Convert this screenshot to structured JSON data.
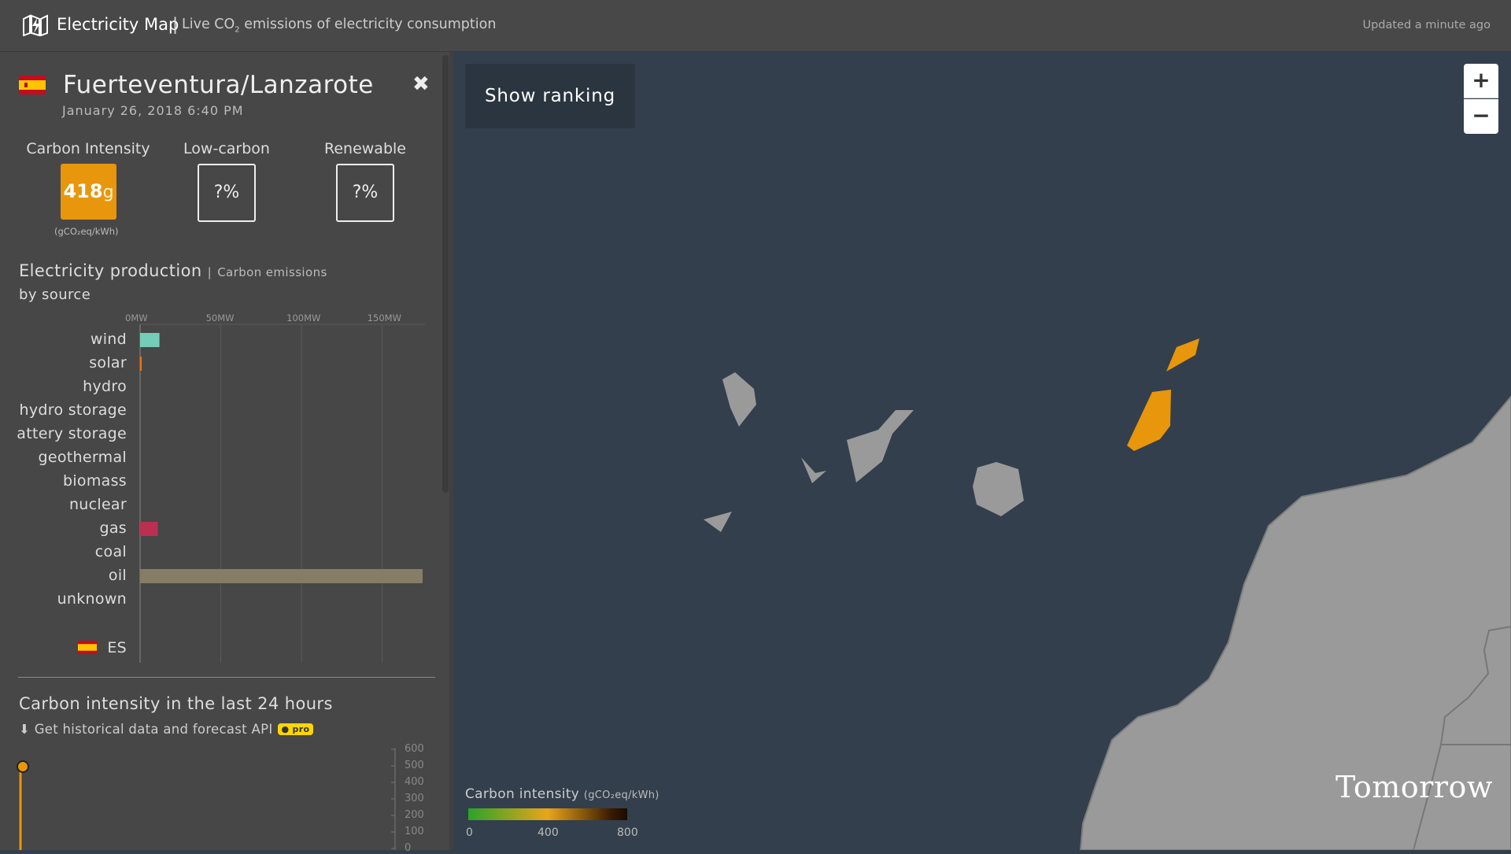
{
  "header": {
    "brand": "Electricity Map",
    "separator": "|",
    "subtitle_pre": "Live CO",
    "subtitle_sub": "2",
    "subtitle_post": " emissions of electricity consumption",
    "updated": "Updated a minute ago"
  },
  "zone": {
    "name": "Fuerteventura/Lanzarote",
    "datetime": "January 26, 2018 6:40 PM",
    "flag_colors": [
      "#c60b1e",
      "#ffc400"
    ]
  },
  "metrics": {
    "carbon_label": "Carbon Intensity",
    "carbon_value": "418",
    "carbon_unit": "g",
    "carbon_color": "#e8960c",
    "carbon_unit_text": "(gCO₂eq/kWh)",
    "lowcarbon_label": "Low-carbon",
    "lowcarbon_value": "?%",
    "renewable_label": "Renewable",
    "renewable_value": "?%"
  },
  "production": {
    "title": "Electricity production",
    "title_sep": "|",
    "alt_link": "Carbon emissions",
    "subtitle": "by source",
    "exchange_label": "ES"
  },
  "chart_data": {
    "type": "bar",
    "orientation": "horizontal",
    "unit": "MW",
    "xlim": [
      0,
      175
    ],
    "x_ticks": [
      "0MW",
      "50MW",
      "100MW",
      "150MW"
    ],
    "categories": [
      "wind",
      "solar",
      "hydro",
      "hydro storage",
      "attery storage",
      "geothermal",
      "biomass",
      "nuclear",
      "gas",
      "coal",
      "oil",
      "unknown"
    ],
    "values": [
      12,
      1,
      0,
      0,
      0,
      0,
      0,
      0,
      11,
      0,
      175,
      0
    ],
    "colors": [
      "#74cdb9",
      "#f27406",
      "#2772b2",
      "#0052cc",
      "#b76fd4",
      "#f5b300",
      "#166a57",
      "#aea940",
      "#bb2f51",
      "#ac8c35",
      "#867d66",
      "#acacac"
    ]
  },
  "history": {
    "title": "Carbon intensity in the last 24 hours",
    "api_link": "Get historical data and forecast API",
    "pro_badge": "pro",
    "y_ticks": [
      "600",
      "500",
      "400",
      "300",
      "200",
      "100",
      "0"
    ]
  },
  "map": {
    "show_ranking": "Show ranking",
    "zoom_in": "+",
    "zoom_out": "−",
    "legend_title": "Carbon intensity",
    "legend_unit": "(gCO₂eq/kWh)",
    "legend_ticks": [
      "0",
      "400",
      "800"
    ],
    "attribution": "Tomorrow",
    "sea_color": "#333f4c",
    "land_color": "#9a9a9a",
    "highlight_color": "#e8960c"
  }
}
